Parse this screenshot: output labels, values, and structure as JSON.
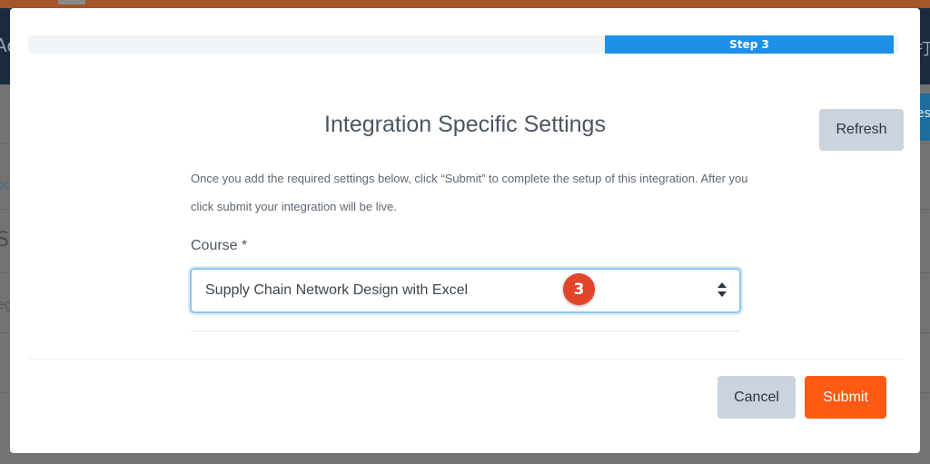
{
  "background": {
    "left_fragments": [
      "Ac",
      "oc",
      "S",
      "eg"
    ],
    "right_fragments": [
      "es",
      "打"
    ]
  },
  "progress": {
    "label": "Step 3",
    "value_percent": 33
  },
  "modal": {
    "title": "Integration Specific Settings",
    "refresh_label": "Refresh",
    "description": "Once you add the required settings below, click “Submit” to complete the setup of this integration. After you click submit your integration will be live.",
    "course_field": {
      "label": "Course *",
      "selected_value": "Supply Chain Network Design with Excel"
    },
    "badge_number": "3",
    "cancel_label": "Cancel",
    "submit_label": "Submit"
  },
  "colors": {
    "accent": "#1d90e8",
    "submit": "#ff5a14",
    "badge": "#e3452b"
  },
  "icons": {
    "select_arrow": "sort-arrows-icon"
  }
}
